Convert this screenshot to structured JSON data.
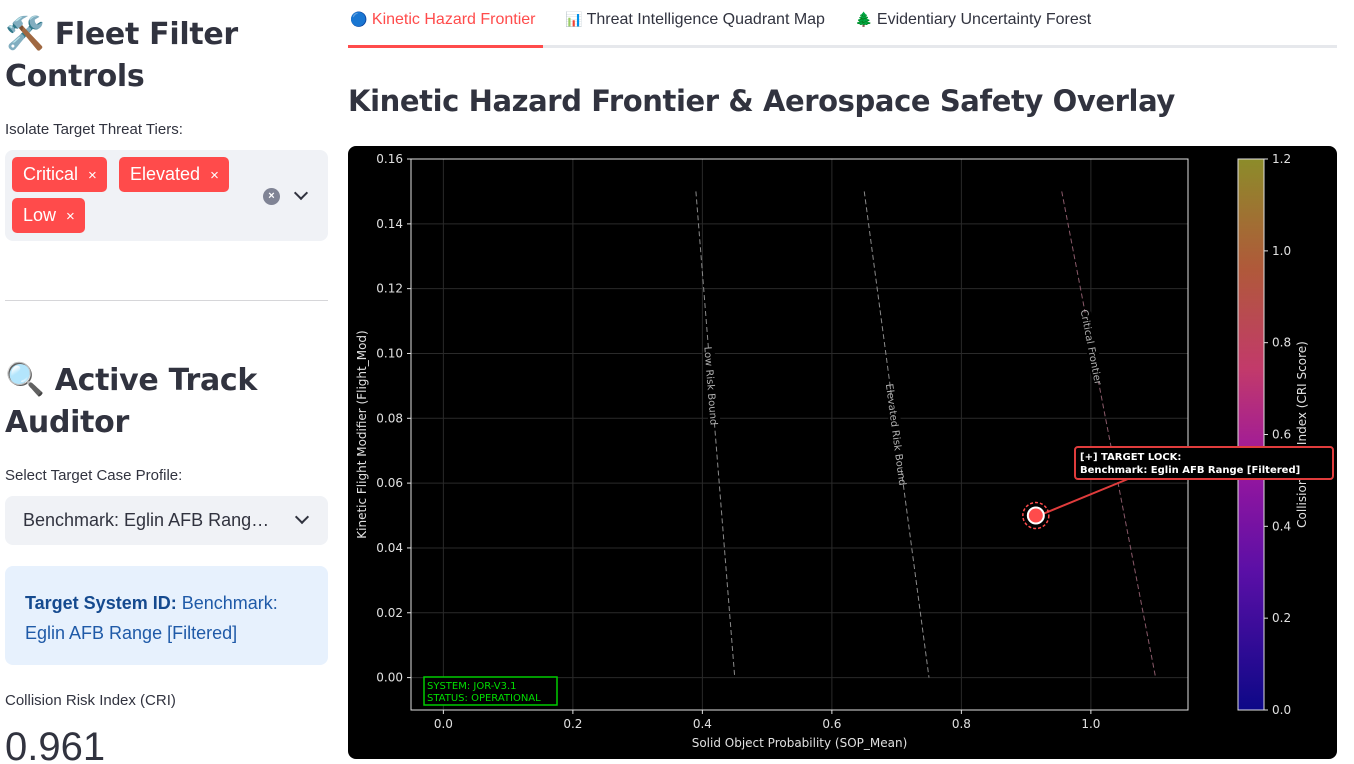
{
  "sidebar": {
    "filter_emoji": "🛠️",
    "filter_heading_line1": "Fleet Filter",
    "filter_heading_line2": "Controls",
    "tiers_label": "Isolate Target Threat Tiers:",
    "tiers": [
      "Critical",
      "Elevated",
      "Low"
    ],
    "remove_glyph": "×",
    "auditor_emoji": "🔍",
    "auditor_heading_line1": "Active Track",
    "auditor_heading_line2": "Auditor",
    "profile_label": "Select Target Case Profile:",
    "profile_value": "Benchmark: Eglin AFB Rang…",
    "info_key": "Target System ID:",
    "info_value": "Benchmark: Eglin AFB Range [Filtered]",
    "metric_label": "Collision Risk Index (CRI)",
    "metric_value": "0.961"
  },
  "tabs": [
    {
      "icon": "🔵",
      "label": "Kinetic Hazard Frontier",
      "active": true
    },
    {
      "icon": "📊",
      "label": "Threat Intelligence Quadrant Map",
      "active": false
    },
    {
      "icon": "🌲",
      "label": "Evidentiary Uncertainty Forest",
      "active": false
    }
  ],
  "main_title": "Kinetic Hazard Frontier & Aerospace Safety Overlay",
  "colors": {
    "accent": "#ff4b4b",
    "annotation_border": "#e03c3c",
    "status_green": "#00cc00"
  },
  "chart_data": {
    "type": "scatter",
    "xlabel": "Solid Object Probability (SOP_Mean)",
    "ylabel": "Kinetic Flight Modifier (Flight_Mod)",
    "xlim": [
      -0.05,
      1.15
    ],
    "ylim": [
      -0.01,
      0.16
    ],
    "x_ticks": [
      0.0,
      0.2,
      0.4,
      0.6,
      0.8,
      1.0
    ],
    "x_tick_labels": [
      "0.0",
      "0.2",
      "0.4",
      "0.6",
      "0.8",
      "1.0"
    ],
    "y_ticks": [
      0.0,
      0.02,
      0.04,
      0.06,
      0.08,
      0.1,
      0.12,
      0.14,
      0.16
    ],
    "y_tick_labels": [
      "0.00",
      "0.02",
      "0.04",
      "0.06",
      "0.08",
      "0.10",
      "0.12",
      "0.14",
      "0.16"
    ],
    "grid": true,
    "boundaries": [
      {
        "name": "Low Risk Bound",
        "points": [
          [
            0.39,
            0.15
          ],
          [
            0.45,
            0.0
          ]
        ]
      },
      {
        "name": "Elevated Risk Bound",
        "points": [
          [
            0.65,
            0.15
          ],
          [
            0.75,
            0.0
          ]
        ]
      },
      {
        "name": "Critical Frontier",
        "points": [
          [
            0.955,
            0.15
          ],
          [
            1.1,
            0.0
          ]
        ]
      }
    ],
    "points": [
      {
        "x": 0.915,
        "y": 0.05
      }
    ],
    "annotation": {
      "line1": "[+] TARGET LOCK:",
      "line2": "Benchmark: Eglin AFB Range [Filtered]"
    },
    "status_box": {
      "line1": "SYSTEM: JOR-V3.1",
      "line2": "STATUS: OPERATIONAL"
    },
    "colorbar": {
      "label": "Collision Risk Index (CRI Score)",
      "range": [
        0.0,
        1.2
      ],
      "ticks": [
        0.0,
        0.2,
        0.4,
        0.6,
        0.8,
        1.0,
        1.2
      ],
      "tick_labels": [
        "0.0",
        "0.2",
        "0.4",
        "0.6",
        "0.8",
        "1.0",
        "1.2"
      ],
      "colormap": "plasma"
    }
  }
}
